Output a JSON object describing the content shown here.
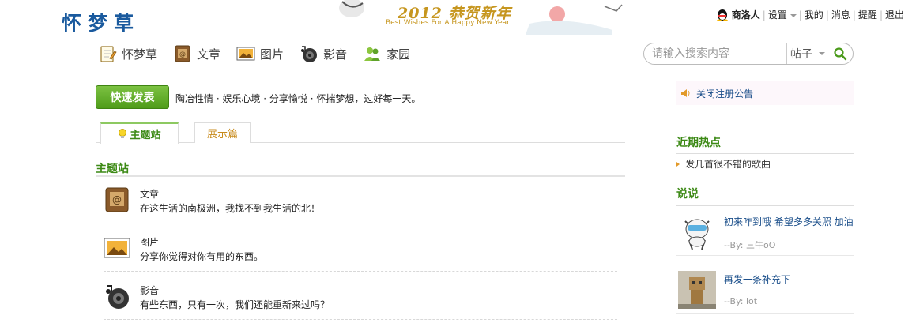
{
  "header": {
    "logo": "怀梦草",
    "banner_title": "2012 恭贺新年",
    "banner_sub": "Best Wishes For A Happy New Year"
  },
  "top_links": {
    "user": "商洛人",
    "settings": "设置",
    "mine": "我的",
    "messages": "消息",
    "remind": "提醒",
    "logout": "退出"
  },
  "nav": [
    {
      "label": "怀梦草",
      "icon": "notepad-icon"
    },
    {
      "label": "文章",
      "icon": "book-icon"
    },
    {
      "label": "图片",
      "icon": "picture-icon"
    },
    {
      "label": "影音",
      "icon": "speaker-icon"
    },
    {
      "label": "家园",
      "icon": "users-icon"
    }
  ],
  "search": {
    "placeholder": "请输入搜索内容",
    "type": "帖子"
  },
  "quick_post": {
    "button": "快速发表",
    "slogan": "陶冶性情 · 娱乐心境 · 分享愉悦 · 怀揣梦想，过好每一天。"
  },
  "tabs": [
    {
      "label": "主题站",
      "active": true
    },
    {
      "label": "展示篇",
      "active": false
    }
  ],
  "section": {
    "title": "主题站",
    "items": [
      {
        "title": "文章",
        "desc": "在这生活的南极洲，我找不到我生活的北！",
        "icon": "book-icon"
      },
      {
        "title": "图片",
        "desc": "分享你觉得对你有用的东西。",
        "icon": "picture-icon"
      },
      {
        "title": "影音",
        "desc": "有些东西，只有一次，我们还能重新来过吗？",
        "icon": "speaker-icon"
      }
    ]
  },
  "sidebar": {
    "notice": "关闭注册公告",
    "hot_title": "近期热点",
    "hot_items": [
      "发几首很不错的歌曲"
    ],
    "talk_title": "说说",
    "talks": [
      {
        "msg": "初来咋到哦  希望多多关照  加油",
        "by": "--By: 三牛oO"
      },
      {
        "msg": "再发一条补充下",
        "by": "--By: lot"
      }
    ]
  },
  "colors": {
    "accent_green": "#3d8a16",
    "link_blue": "#1a4e8a",
    "logo_blue": "#1a5a9e",
    "gold": "#c6961f"
  }
}
